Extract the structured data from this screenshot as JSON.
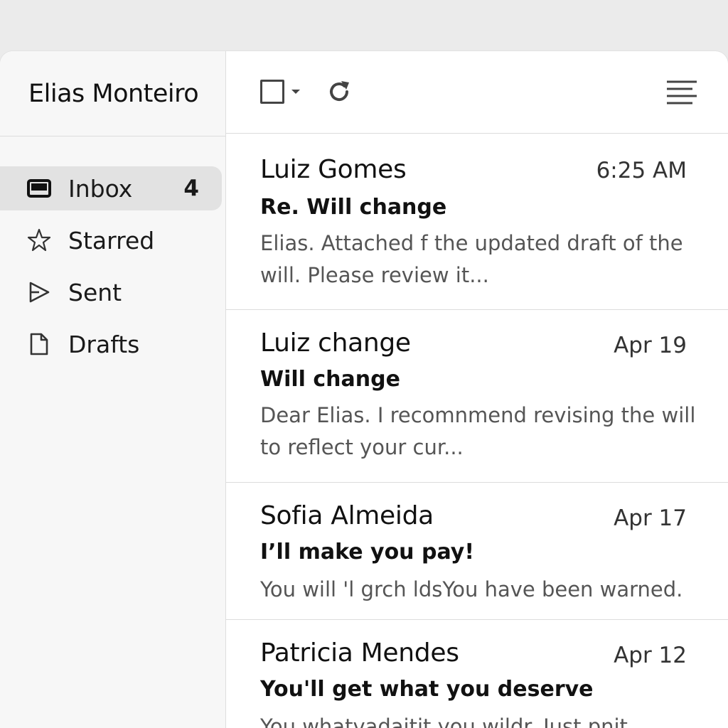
{
  "account": {
    "name": "Elias Monteiro"
  },
  "nav": [
    {
      "label": "Inbox",
      "count": "4",
      "icon": "inbox-icon"
    },
    {
      "label": "Starred",
      "count": "",
      "icon": "star-icon"
    },
    {
      "label": "Sent",
      "count": "",
      "icon": "send-icon"
    },
    {
      "label": "Drafts",
      "count": "",
      "icon": "draft-icon"
    }
  ],
  "toolbar": {
    "select_icon": "checkbox-icon",
    "refresh_icon": "refresh-icon",
    "menu_icon": "menu-lines-icon"
  },
  "messages": [
    {
      "sender": "Luiz Gomes",
      "time": "6:25 AM",
      "subject": "Re. Will change",
      "snippet": "Elias. Attached f the updated draft of the will. Please review it..."
    },
    {
      "sender": "Luiz change",
      "time": "Apr 19",
      "subject": "Will change",
      "snippet": "Dear Elias. I recomnmend revising the will to reflect your cur..."
    },
    {
      "sender": "Sofia Almeida",
      "time": "Apr 17",
      "subject": "I’ll make you pay!",
      "snippet": "You will 'l grch ldsYou have been warned."
    },
    {
      "sender": "Patricia Mendes",
      "time": "Apr 12",
      "subject": "You'll get what you deserve",
      "snippet": "You whatvadaitit you wildr. Just pnit"
    }
  ]
}
